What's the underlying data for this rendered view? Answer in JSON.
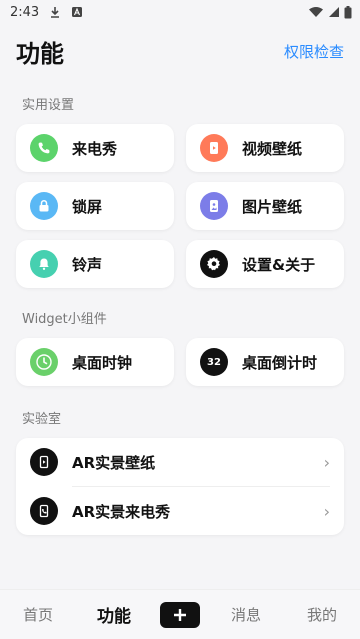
{
  "status_bar": {
    "time": "2:43"
  },
  "header": {
    "title": "功能",
    "permission_link": "权限检查"
  },
  "sections": {
    "practical": {
      "label": "实用设置",
      "items": [
        {
          "label": "来电秀",
          "icon": "phone-icon",
          "color": "#5cd36b"
        },
        {
          "label": "视频壁纸",
          "icon": "video-wallpaper-icon",
          "color": "#ff7a59"
        },
        {
          "label": "锁屏",
          "icon": "lock-icon",
          "color": "#5ab8f5"
        },
        {
          "label": "图片壁纸",
          "icon": "image-wallpaper-icon",
          "color": "#7c7de8"
        },
        {
          "label": "铃声",
          "icon": "bell-icon",
          "color": "#46d0b0"
        },
        {
          "label": "设置&关于",
          "icon": "gear-icon",
          "color": "#111111"
        }
      ]
    },
    "widget": {
      "label": "Widget小组件",
      "items": [
        {
          "label": "桌面时钟",
          "icon": "clock-icon",
          "color": "#6ad06a"
        },
        {
          "label": "桌面倒计时",
          "icon": "countdown-icon",
          "badge": "32",
          "color": "#111111"
        }
      ]
    },
    "lab": {
      "label": "实验室",
      "items": [
        {
          "label": "AR实景壁纸",
          "icon": "ar-wallpaper-icon"
        },
        {
          "label": "AR实景来电秀",
          "icon": "ar-call-show-icon"
        }
      ]
    }
  },
  "bottom_nav": {
    "items": [
      {
        "label": "首页"
      },
      {
        "label": "功能",
        "active": true
      },
      {
        "label": "消息"
      },
      {
        "label": "我的"
      }
    ]
  }
}
